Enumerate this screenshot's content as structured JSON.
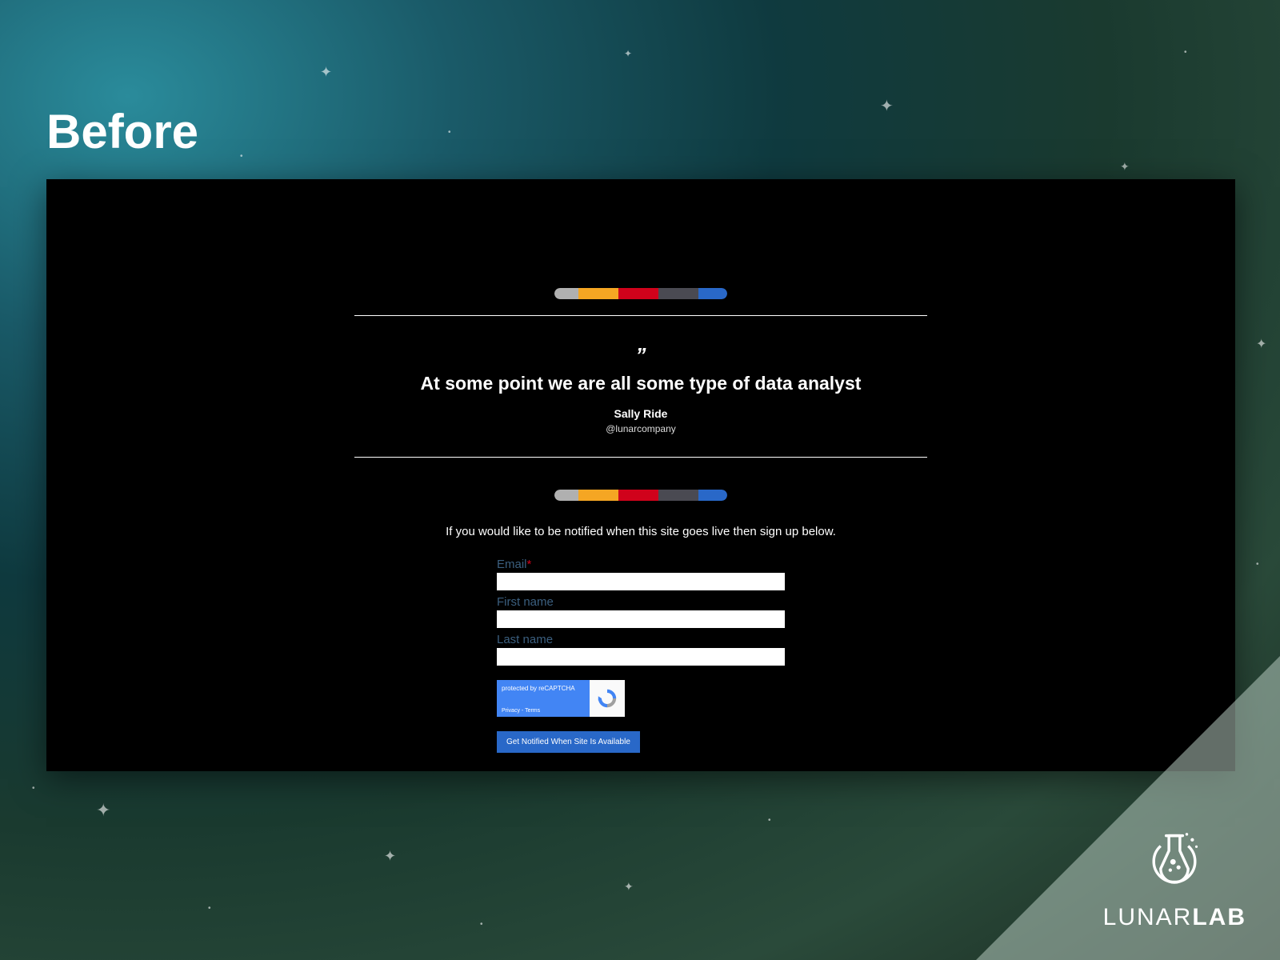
{
  "slide": {
    "title": "Before"
  },
  "quote": {
    "mark": "”",
    "text": "At some point we are all some type of data analyst",
    "author": "Sally Ride",
    "handle": "@lunarcompany"
  },
  "signup": {
    "intro": "If you would like to be notified when this site goes live then sign up below.",
    "email_label": "Email",
    "required_mark": "*",
    "firstname_label": "First name",
    "lastname_label": "Last name",
    "submit_label": "Get Notified When Site Is Available"
  },
  "recaptcha": {
    "protected_text": "protected by reCAPTCHA",
    "privacy": "Privacy",
    "terms": "Terms",
    "sep": " - "
  },
  "brand": {
    "name_light": "LUNAR",
    "name_bold": "LAB"
  },
  "color_bar": {
    "colors": [
      "#b0b0b0",
      "#f5a623",
      "#d0021b",
      "#4a4a52",
      "#2968c8"
    ]
  }
}
